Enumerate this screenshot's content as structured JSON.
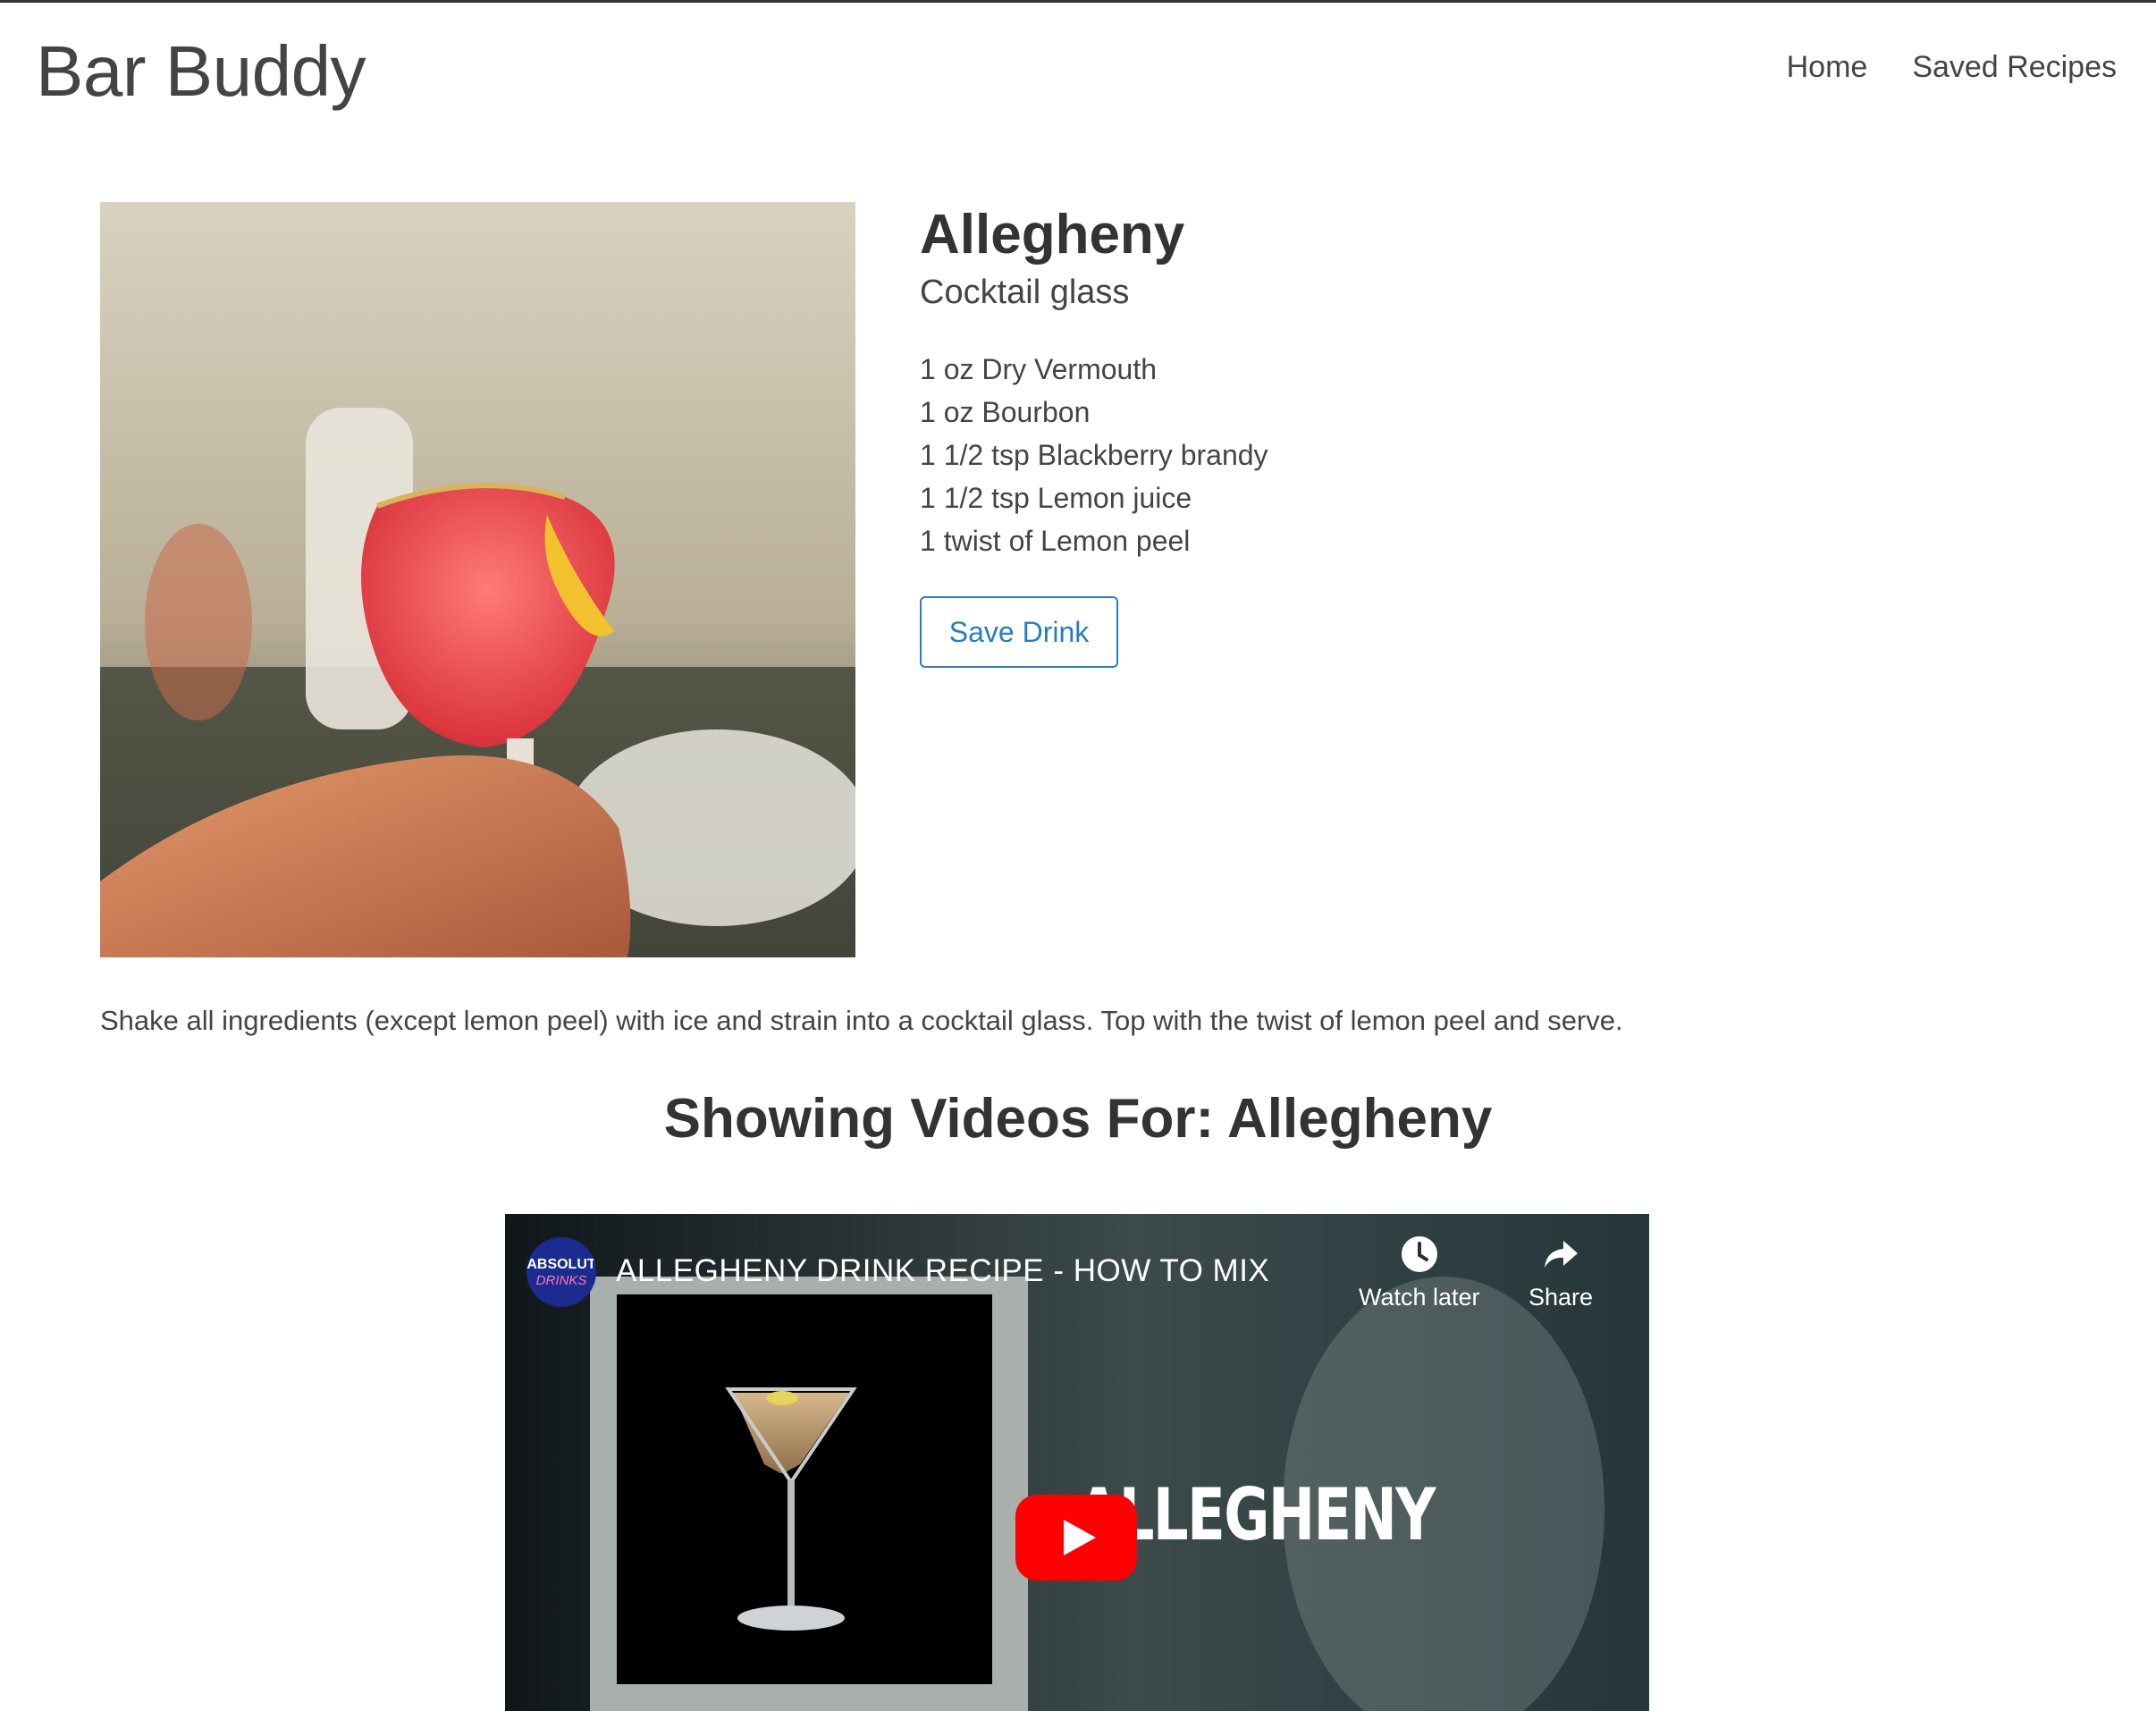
{
  "header": {
    "brand": "Bar Buddy",
    "nav": [
      {
        "label": "Home"
      },
      {
        "label": "Saved Recipes"
      }
    ]
  },
  "drink": {
    "name": "Allegheny",
    "glass": "Cocktail glass",
    "ingredients": [
      "1 oz Dry Vermouth",
      "1 oz Bourbon",
      "1 1/2 tsp Blackberry brandy",
      "1 1/2 tsp Lemon juice",
      "1 twist of Lemon peel"
    ],
    "save_label": "Save Drink",
    "instructions": "Shake all ingredients (except lemon peel) with ice and strain into a cocktail glass. Top with the twist of lemon peel and serve."
  },
  "videos": {
    "heading": "Showing Videos For: Allegheny",
    "player": {
      "channel_logo_line1": "ABSOLUT",
      "channel_logo_line2": "DRINKS",
      "title": "ALLEGHENY DRINK RECIPE - HOW TO MIX",
      "watch_later_label": "Watch later",
      "share_label": "Share",
      "thumbnail_text": "ALLEGHENY"
    }
  },
  "colors": {
    "accent": "#2a7bc3",
    "text": "#333333",
    "youtube_red": "#ff0000"
  },
  "icons": [
    "clock-icon",
    "share-arrow-icon",
    "play-icon"
  ]
}
